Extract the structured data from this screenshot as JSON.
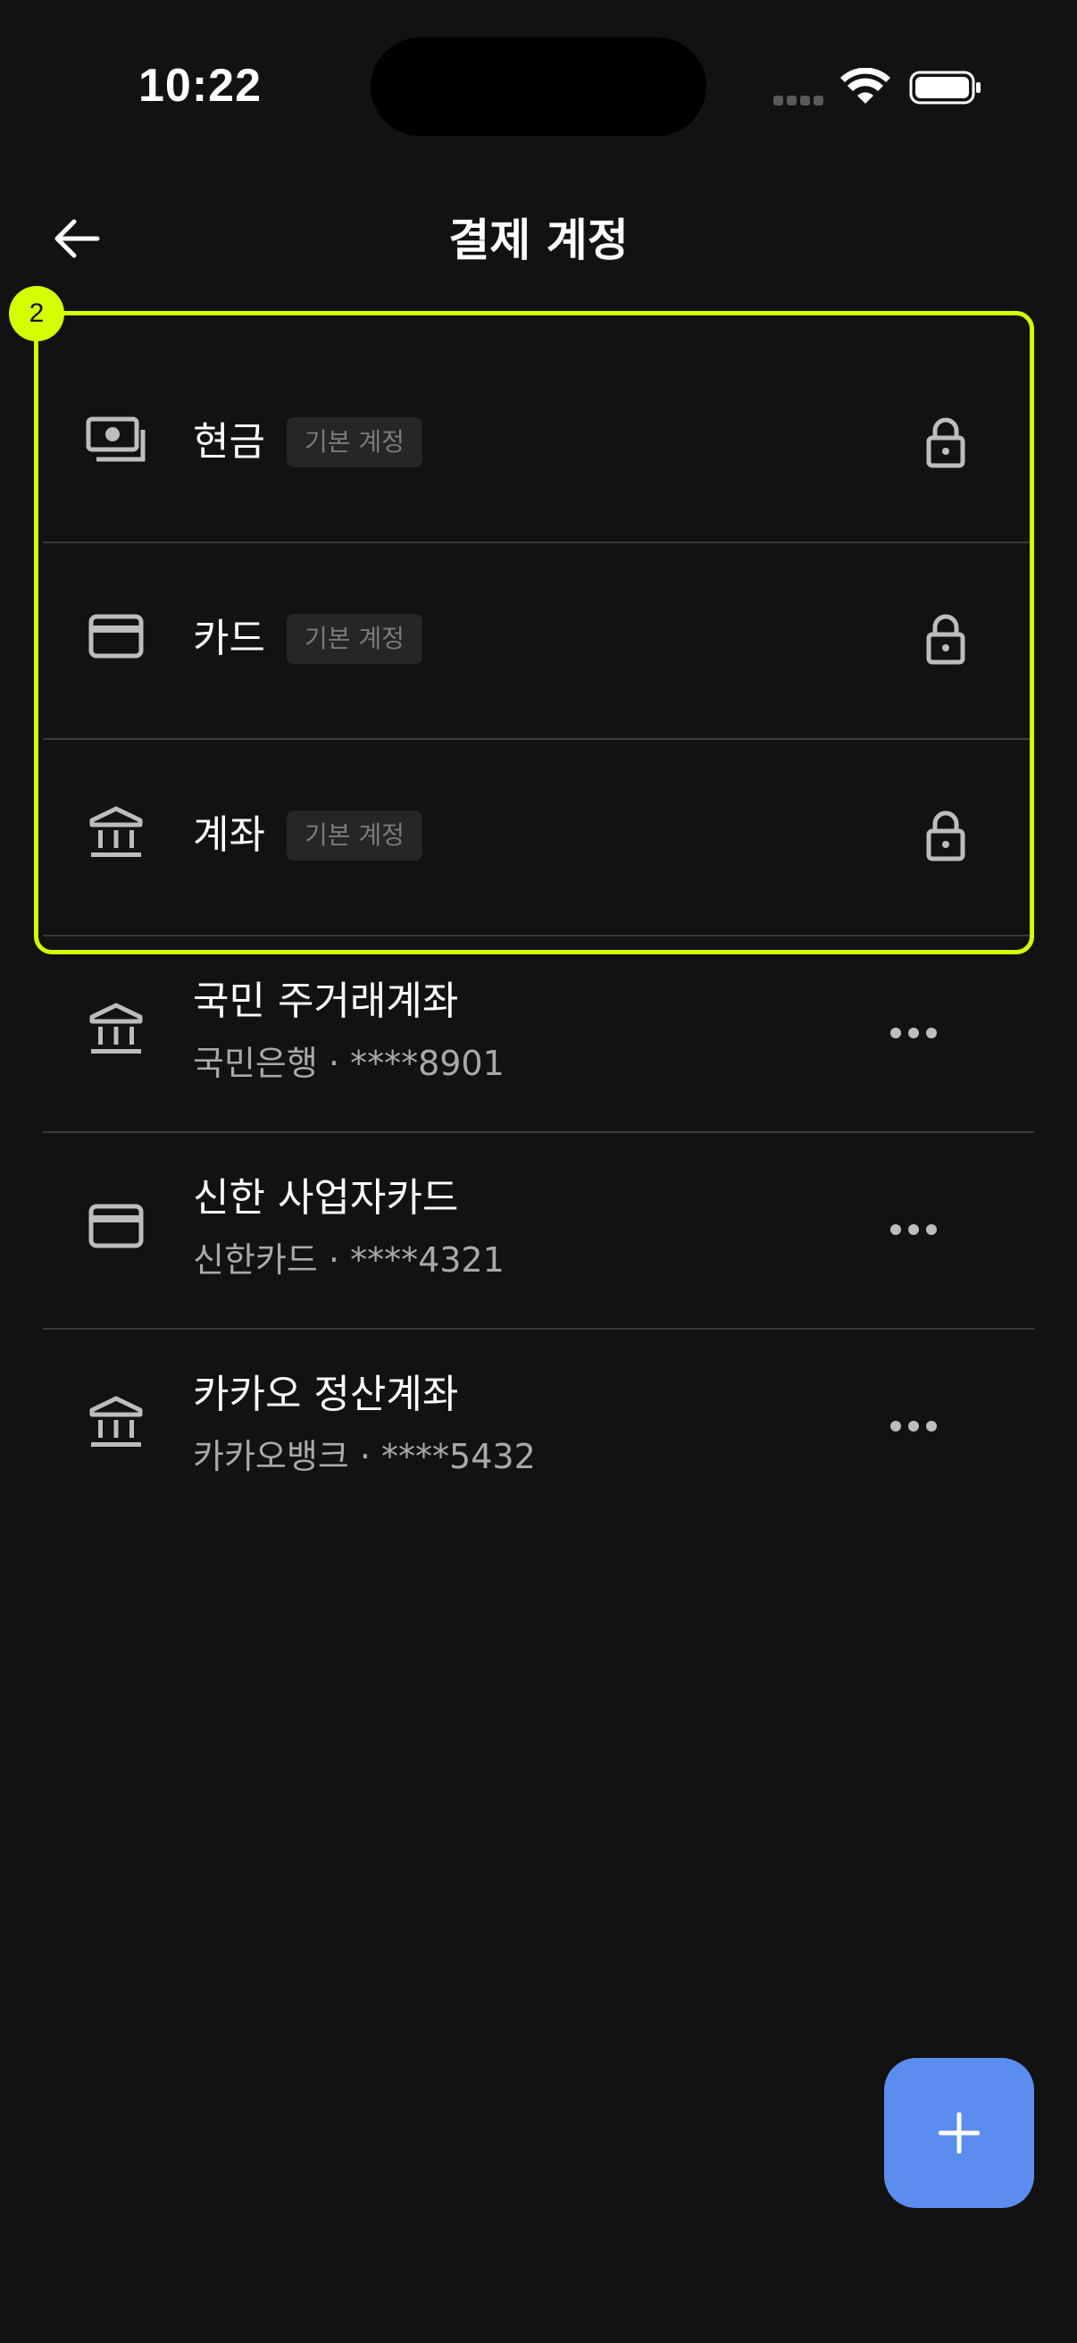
{
  "status_bar": {
    "time": "10:22"
  },
  "header": {
    "title": "결제 계정",
    "back_icon": "arrow-left-icon"
  },
  "default_accounts": [
    {
      "name": "현금",
      "badge": "기본 계정",
      "icon": "cash-icon",
      "trailing_icon": "lock-icon"
    },
    {
      "name": "카드",
      "badge": "기본 계정",
      "icon": "card-icon",
      "trailing_icon": "lock-icon"
    },
    {
      "name": "계좌",
      "badge": "기본 계정",
      "icon": "bank-icon",
      "trailing_icon": "lock-icon"
    }
  ],
  "user_accounts": [
    {
      "name": "국민 주거래계좌",
      "detail": "국민은행 · ****8901",
      "icon": "bank-icon",
      "trailing_icon": "more-icon"
    },
    {
      "name": "신한 사업자카드",
      "detail": "신한카드 · ****4321",
      "icon": "card-icon",
      "trailing_icon": "more-icon"
    },
    {
      "name": "카카오 정산계좌",
      "detail": "카카오뱅크 · ****5432",
      "icon": "bank-icon",
      "trailing_icon": "more-icon"
    }
  ],
  "highlight": {
    "label": "2",
    "color": "#d6ff00"
  },
  "fab": {
    "icon": "plus-icon",
    "color": "#5b8def"
  },
  "colors": {
    "background": "#121212",
    "badge_bg": "#262626",
    "divider": "#3a3a3a",
    "secondary_text": "#a9a9a9"
  }
}
